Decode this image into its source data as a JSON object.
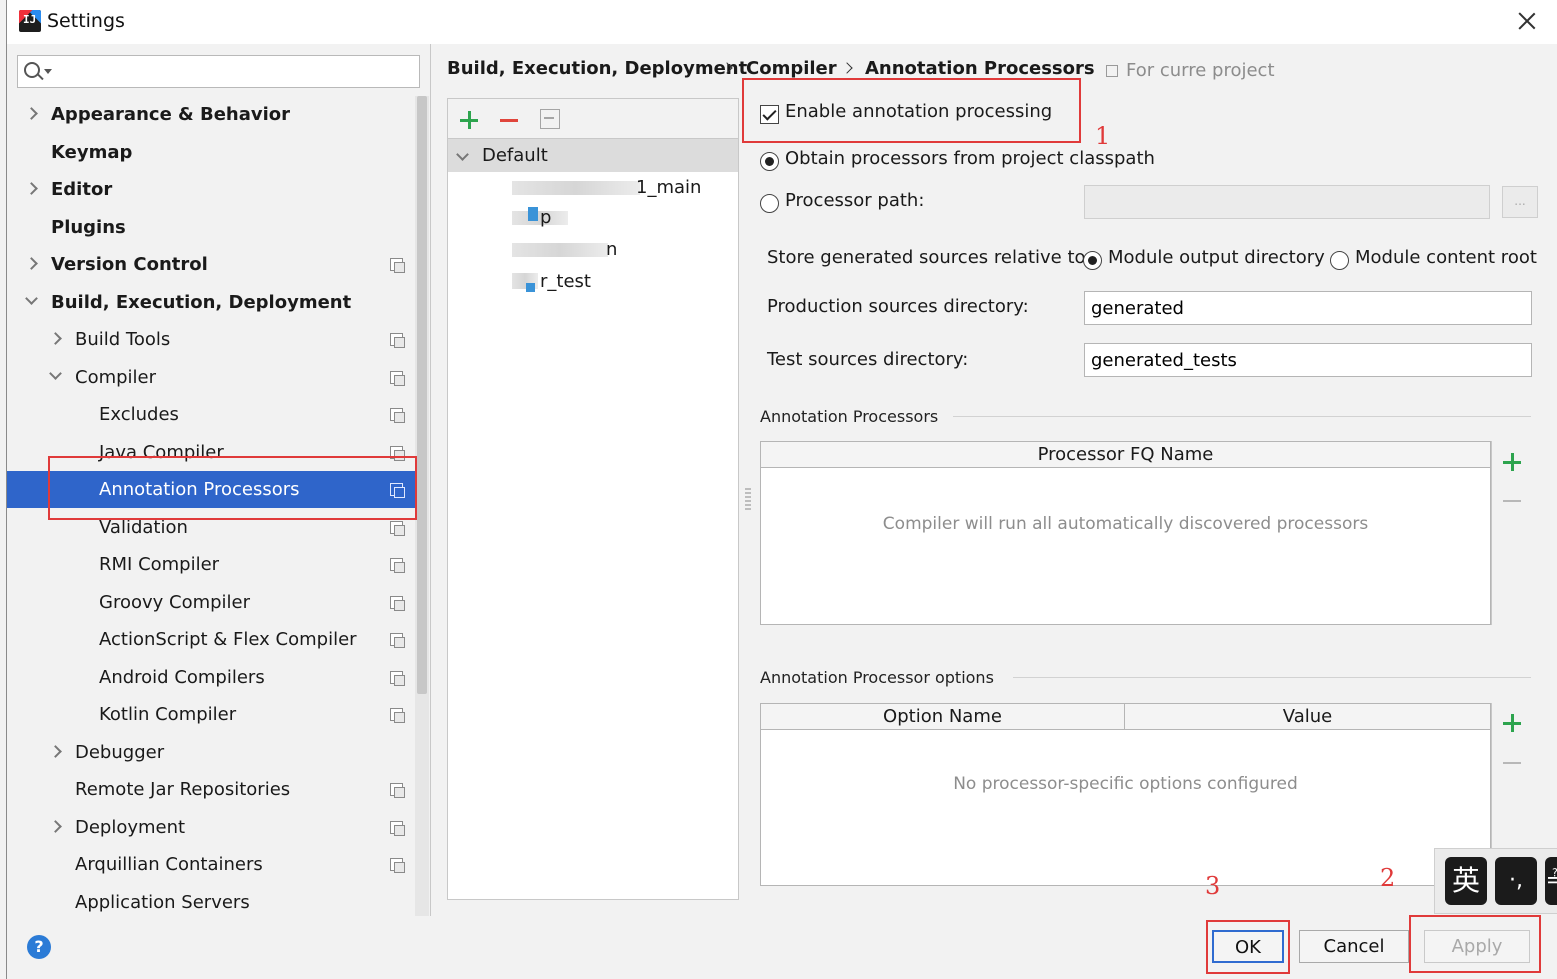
{
  "window": {
    "title": "Settings",
    "app_icon": "intellij-idea-icon",
    "close_icon": "close-icon"
  },
  "search": {
    "placeholder": "",
    "value": ""
  },
  "tree": [
    {
      "label": "Appearance & Behavior",
      "bold": true,
      "expand": "collapsed",
      "level": 0,
      "project": false
    },
    {
      "label": "Keymap",
      "bold": true,
      "expand": "none",
      "level": 0,
      "project": false
    },
    {
      "label": "Editor",
      "bold": true,
      "expand": "collapsed",
      "level": 0,
      "project": false
    },
    {
      "label": "Plugins",
      "bold": true,
      "expand": "none",
      "level": 0,
      "project": false
    },
    {
      "label": "Version Control",
      "bold": true,
      "expand": "collapsed",
      "level": 0,
      "project": true
    },
    {
      "label": "Build, Execution, Deployment",
      "bold": true,
      "expand": "expanded",
      "level": 0,
      "project": false
    },
    {
      "label": "Build Tools",
      "bold": false,
      "expand": "collapsed",
      "level": 1,
      "project": true
    },
    {
      "label": "Compiler",
      "bold": false,
      "expand": "expanded",
      "level": 1,
      "project": true
    },
    {
      "label": "Excludes",
      "bold": false,
      "expand": "none",
      "level": 2,
      "project": true
    },
    {
      "label": "Java Compiler",
      "bold": false,
      "expand": "none",
      "level": 2,
      "project": true
    },
    {
      "label": "Annotation Processors",
      "bold": false,
      "expand": "none",
      "level": 2,
      "project": true,
      "selected": true
    },
    {
      "label": "Validation",
      "bold": false,
      "expand": "none",
      "level": 2,
      "project": true
    },
    {
      "label": "RMI Compiler",
      "bold": false,
      "expand": "none",
      "level": 2,
      "project": true
    },
    {
      "label": "Groovy Compiler",
      "bold": false,
      "expand": "none",
      "level": 2,
      "project": true
    },
    {
      "label": "ActionScript & Flex Compiler",
      "bold": false,
      "expand": "none",
      "level": 2,
      "project": true
    },
    {
      "label": "Android Compilers",
      "bold": false,
      "expand": "none",
      "level": 2,
      "project": true
    },
    {
      "label": "Kotlin Compiler",
      "bold": false,
      "expand": "none",
      "level": 2,
      "project": true
    },
    {
      "label": "Debugger",
      "bold": false,
      "expand": "collapsed",
      "level": 1,
      "project": false
    },
    {
      "label": "Remote Jar Repositories",
      "bold": false,
      "expand": "none",
      "level": 1,
      "project": true
    },
    {
      "label": "Deployment",
      "bold": false,
      "expand": "collapsed",
      "level": 1,
      "project": true
    },
    {
      "label": "Arquillian Containers",
      "bold": false,
      "expand": "none",
      "level": 1,
      "project": true
    },
    {
      "label": "Application Servers",
      "bold": false,
      "expand": "none",
      "level": 1,
      "project": false
    }
  ],
  "breadcrumb": {
    "items": [
      "Build, Execution, Deployment",
      "Compiler",
      "Annotation Processors"
    ],
    "scope": "For curre    project"
  },
  "profiles": {
    "default_label": "Default",
    "modules": [
      "1_main",
      "p",
      "n",
      "r_test"
    ]
  },
  "settings": {
    "enable_label": "Enable annotation processing",
    "enable_checked": true,
    "obtain_label": "Obtain processors from project classpath",
    "processor_path_label": "Processor path:",
    "processor_path_value": "",
    "source_choice": "obtain",
    "store_label": "Store generated sources relative to:",
    "module_output_label": "Module output directory",
    "module_content_label": "Module content root",
    "store_choice": "module_output",
    "production_label": "Production sources directory:",
    "production_value": "generated",
    "test_label": "Test sources directory:",
    "test_value": "generated_tests",
    "browse_label": "..."
  },
  "processors_group": {
    "title": "Annotation Processors",
    "column": "Processor FQ Name",
    "empty": "Compiler will run all automatically discovered processors"
  },
  "options_group": {
    "title": "Annotation Processor options",
    "col_name": "Option Name",
    "col_value": "Value",
    "empty": "No processor-specific options configured"
  },
  "annotations": {
    "n1": "1",
    "n2": "2",
    "n3": "3",
    "color": "#e03a3a"
  },
  "buttons": {
    "ok": "OK",
    "cancel": "Cancel",
    "apply": "Apply",
    "help": "?"
  },
  "ime": {
    "key1": "英",
    "key2": "·,",
    "key3": "≟"
  },
  "colors": {
    "selection": "#2f65ca",
    "add_green": "#2da44e",
    "remove_red": "#e0453b"
  }
}
